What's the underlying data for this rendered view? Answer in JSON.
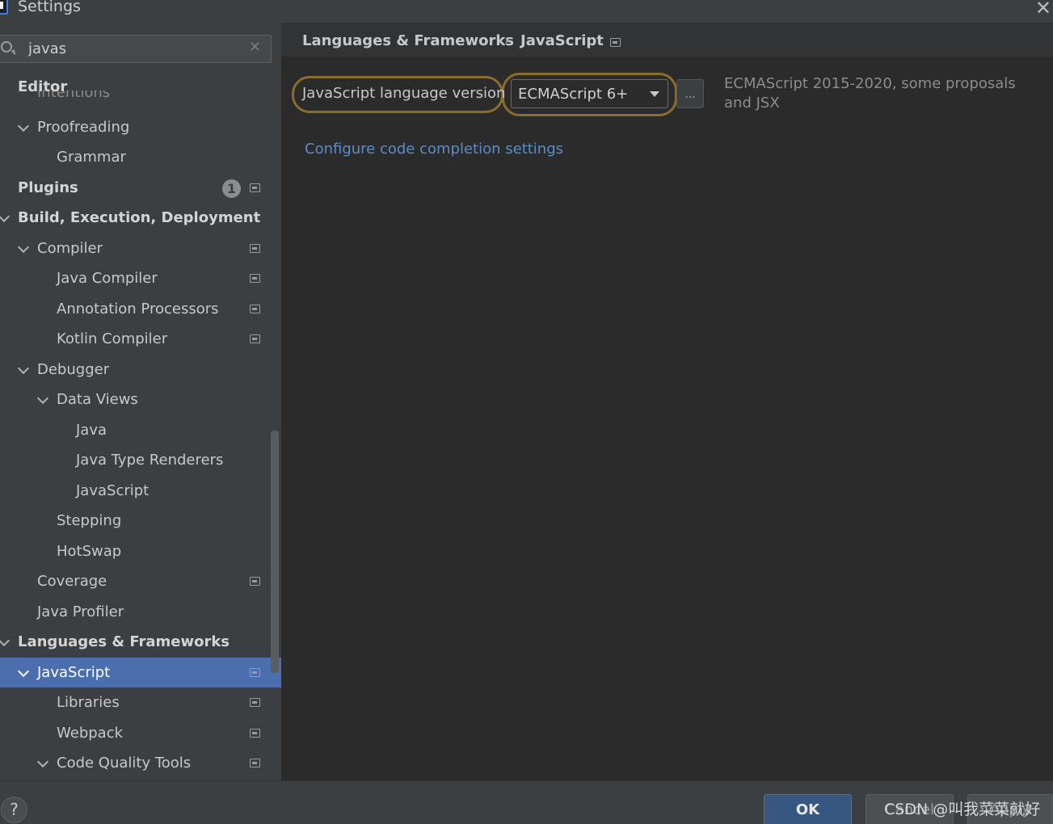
{
  "window": {
    "title": "Settings"
  },
  "search": {
    "value": "javas",
    "placeholder": ""
  },
  "sidebar": {
    "partial_item": "Intentions",
    "items": [
      {
        "label": "Editor",
        "bold": true
      },
      {
        "label": "Proofreading",
        "expanded": true
      },
      {
        "label": "Grammar"
      },
      {
        "label": "Plugins",
        "bold": true,
        "badge": "1"
      },
      {
        "label": "Build, Execution, Deployment",
        "bold": true,
        "expanded": true
      },
      {
        "label": "Compiler",
        "expanded": true
      },
      {
        "label": "Java Compiler"
      },
      {
        "label": "Annotation Processors"
      },
      {
        "label": "Kotlin Compiler"
      },
      {
        "label": "Debugger",
        "expanded": true
      },
      {
        "label": "Data Views",
        "expanded": true
      },
      {
        "label": "Java"
      },
      {
        "label": "Java Type Renderers"
      },
      {
        "label": "JavaScript"
      },
      {
        "label": "Stepping"
      },
      {
        "label": "HotSwap"
      },
      {
        "label": "Coverage"
      },
      {
        "label": "Java Profiler"
      },
      {
        "label": "Languages & Frameworks",
        "bold": true,
        "expanded": true
      },
      {
        "label": "JavaScript",
        "selected": true,
        "expanded": true
      },
      {
        "label": "Libraries"
      },
      {
        "label": "Webpack"
      },
      {
        "label": "Code Quality Tools",
        "expanded": true
      }
    ]
  },
  "breadcrumb": {
    "parent": "Languages & Frameworks",
    "separator": "›",
    "current": "JavaScript"
  },
  "content": {
    "language_version_label": "JavaScript language version",
    "language_version_value": "ECMAScript 6+",
    "ellipsis_label": "...",
    "description": "ECMAScript 2015-2020, some proposals and JSX",
    "config_link": "Configure code completion settings"
  },
  "footer": {
    "help_label": "?",
    "ok_label": "OK",
    "cancel_label": "Cancel",
    "apply_label": "Apply",
    "watermark": "CSDN @叫我菜菜就好"
  },
  "colors": {
    "selection": "#4b6eaf",
    "link": "#5a8dc6",
    "highlight": "#8a6d2e",
    "ok_button": "#365880"
  }
}
